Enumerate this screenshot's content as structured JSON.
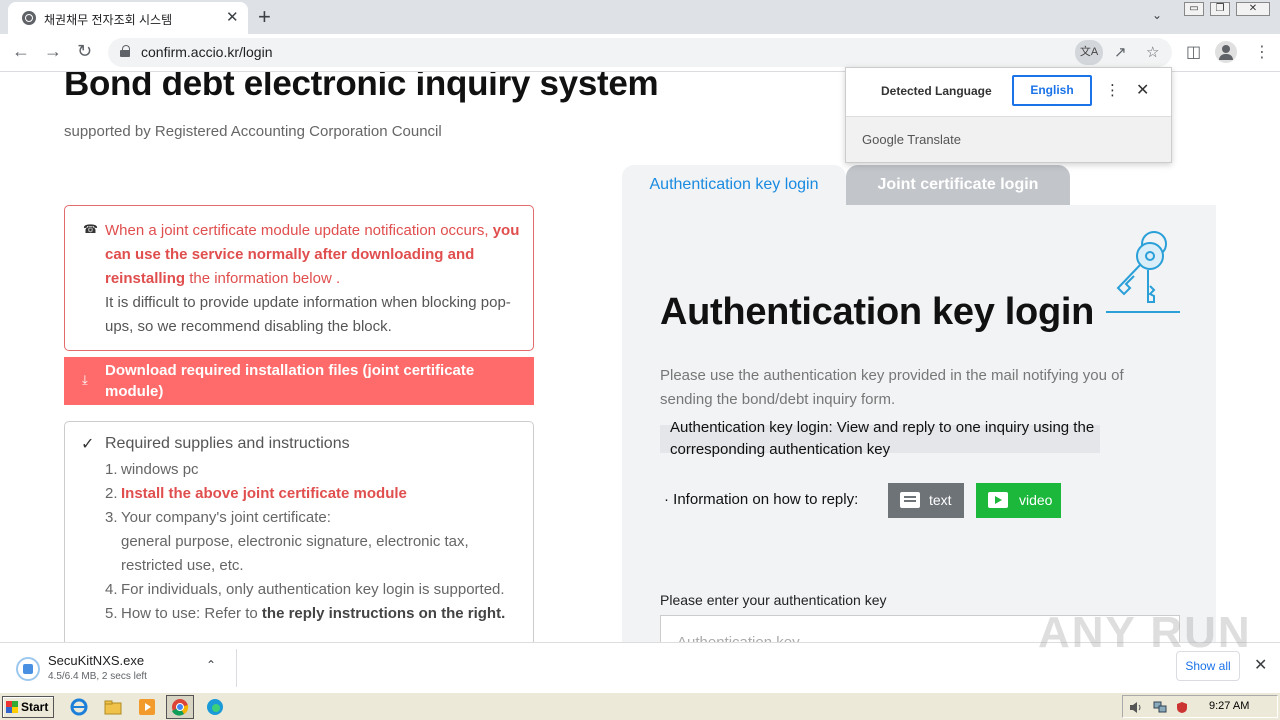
{
  "browser": {
    "tab_title": "채권채무 전자조회 시스템",
    "tab_close": "✕",
    "new_tab": "+",
    "url": "confirm.accio.kr/login",
    "window_buttons": [
      "▭",
      "❐",
      "✕"
    ]
  },
  "translate_popup": {
    "detected_language": "Detected Language",
    "target_language": "English",
    "more": "⋮",
    "close": "✕",
    "provider": "Google Translate"
  },
  "page": {
    "title": "Bond debt electronic inquiry system",
    "subtitle": "supported by Registered Accounting Corporation Council",
    "notice": {
      "line1": "When a joint certificate module update notification occurs,",
      "bold": "you can use the service normally after downloading and reinstalling",
      "line2": " the information below .",
      "line3": "It is difficult to provide update information when blocking pop-ups, so we recommend disabling the block."
    },
    "download_button": "Download required installation files (joint certificate module)",
    "supplies": {
      "heading": "Required supplies and instructions",
      "item1": "windows pc",
      "item2": "Install the above joint certificate module",
      "item3a": "Your company's joint certificate:",
      "item3b": "general purpose, electronic signature, electronic tax, restricted use, etc.",
      "item4": "For individuals, only authentication key login is supported.",
      "item5a": "How to use: Refer to ",
      "item5b": "the reply instructions on the right."
    }
  },
  "login_panel": {
    "tabs": [
      "Authentication key login",
      "Joint certificate login"
    ],
    "title": "Authentication key login",
    "description": "Please use the authentication key provided in the mail notifying you of sending the bond/debt inquiry form.",
    "note": "Authentication key login: View and reply to one inquiry using the corresponding authentication key",
    "reply_info": "Information on how to reply:",
    "text_button": "text",
    "video_button": "video",
    "key_label": "Please enter your authentication key",
    "key_placeholder": "Authentication key"
  },
  "download_bar": {
    "file_name": "SecuKitNXS.exe",
    "status": "4.5/6.4 MB, 2 secs left",
    "show_all": "Show all",
    "watermark": "ANY RUN"
  },
  "taskbar": {
    "start": "Start",
    "clock": "9:27 AM"
  },
  "colors": {
    "accent_red": "#ff6b6b",
    "link_blue": "#1a8be0",
    "video_green": "#1bb83b"
  }
}
